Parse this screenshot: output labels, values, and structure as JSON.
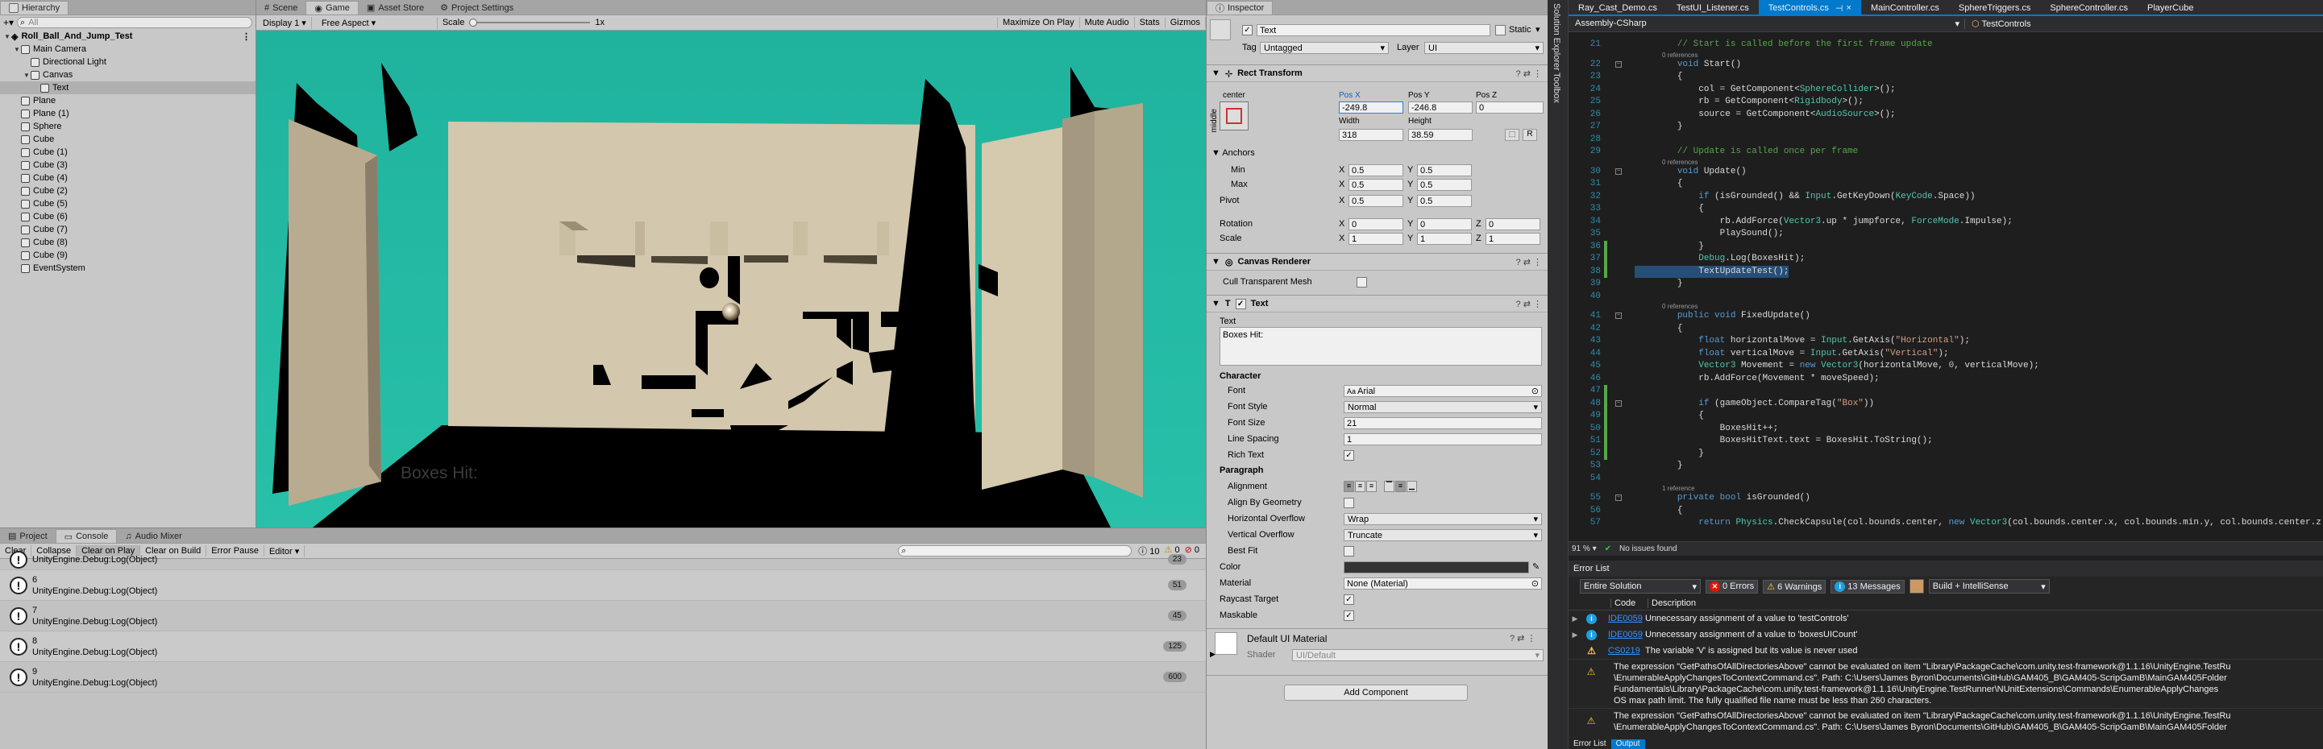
{
  "hierarchy": {
    "tab": "Hierarchy",
    "search_placeholder": "All",
    "scene": "Roll_Ball_And_Jump_Test",
    "items": [
      {
        "label": "Main Camera",
        "depth": 1
      },
      {
        "label": "Directional Light",
        "depth": 2
      },
      {
        "label": "Canvas",
        "depth": 2
      },
      {
        "label": "Text",
        "depth": 3
      },
      {
        "label": "Plane",
        "depth": 1
      },
      {
        "label": "Plane (1)",
        "depth": 1
      },
      {
        "label": "Sphere",
        "depth": 1
      },
      {
        "label": "Cube",
        "depth": 1
      },
      {
        "label": "Cube (1)",
        "depth": 1
      },
      {
        "label": "Cube (3)",
        "depth": 1
      },
      {
        "label": "Cube (4)",
        "depth": 1
      },
      {
        "label": "Cube (2)",
        "depth": 1
      },
      {
        "label": "Cube (5)",
        "depth": 1
      },
      {
        "label": "Cube (6)",
        "depth": 1
      },
      {
        "label": "Cube (7)",
        "depth": 1
      },
      {
        "label": "Cube (8)",
        "depth": 1
      },
      {
        "label": "Cube (9)",
        "depth": 1
      },
      {
        "label": "EventSystem",
        "depth": 1
      }
    ]
  },
  "game": {
    "tabs": [
      "Scene",
      "Game",
      "Asset Store",
      "Project Settings"
    ],
    "display": "Display 1",
    "aspect": "Free Aspect",
    "scale_label": "Scale",
    "scale_value": "1x",
    "buttons": [
      "Maximize On Play",
      "Mute Audio",
      "Stats",
      "Gizmos"
    ],
    "overlay_text": "Boxes Hit:"
  },
  "console": {
    "tabs": [
      "Project",
      "Console",
      "Audio Mixer"
    ],
    "buttons": [
      "Clear",
      "Collapse",
      "Clear on Play",
      "Clear on Build",
      "Error Pause",
      "Editor"
    ],
    "counts": [
      "10",
      "0",
      "0"
    ],
    "rows": [
      {
        "title": "",
        "msg": "UnityEngine.Debug:Log(Object)",
        "count": "23"
      },
      {
        "title": "6",
        "msg": "UnityEngine.Debug:Log(Object)",
        "count": "51"
      },
      {
        "title": "7",
        "msg": "UnityEngine.Debug:Log(Object)",
        "count": "45"
      },
      {
        "title": "8",
        "msg": "UnityEngine.Debug:Log(Object)",
        "count": "125"
      },
      {
        "title": "9",
        "msg": "UnityEngine.Debug:Log(Object)",
        "count": "600"
      }
    ]
  },
  "inspector": {
    "tab": "Inspector",
    "name": "Text",
    "static": "Static",
    "tag_label": "Tag",
    "tag": "Untagged",
    "layer_label": "Layer",
    "layer": "UI",
    "rect": {
      "title": "Rect Transform",
      "anchor_label": "center",
      "side": "middle",
      "posx_l": "Pos X",
      "posy_l": "Pos Y",
      "posz_l": "Pos Z",
      "posx": "-249.8",
      "posy": "-246.8",
      "posz": "0",
      "width_l": "Width",
      "height_l": "Height",
      "width": "318",
      "height": "38.59",
      "r": "R",
      "anchors": "Anchors",
      "min": "Min",
      "max": "Max",
      "pivot": "Pivot",
      "minx": "0.5",
      "miny": "0.5",
      "maxx": "0.5",
      "maxy": "0.5",
      "pivx": "0.5",
      "pivy": "0.5",
      "rotation": "Rotation",
      "scale": "Scale",
      "rx": "0",
      "ry": "0",
      "rz": "0",
      "sx": "1",
      "sy": "1",
      "sz": "1"
    },
    "canvas_renderer": {
      "title": "Canvas Renderer",
      "cull": "Cull Transparent Mesh"
    },
    "text": {
      "title": "Text",
      "text_label": "Text",
      "text_value": "Boxes Hit:",
      "character": "Character",
      "font_l": "Font",
      "font": "Arial",
      "style_l": "Font Style",
      "style": "Normal",
      "size_l": "Font Size",
      "size": "21",
      "spacing_l": "Line Spacing",
      "spacing": "1",
      "rich_l": "Rich Text",
      "paragraph": "Paragraph",
      "align_l": "Alignment",
      "geom_l": "Align By Geometry",
      "hov_l": "Horizontal Overflow",
      "hov": "Wrap",
      "vov_l": "Vertical Overflow",
      "vov": "Truncate",
      "bestfit_l": "Best Fit",
      "color_l": "Color",
      "material_l": "Material",
      "material": "None (Material)",
      "raycast_l": "Raycast Target",
      "maskable_l": "Maskable"
    },
    "default_mat": "Default UI Material",
    "shader_l": "Shader",
    "shader": "UI/Default",
    "add_component": "Add Component"
  },
  "vs": {
    "side_labels": [
      "Solution Explorer",
      "Toolbox"
    ],
    "tabs": [
      "Ray_Cast_Demo.cs",
      "TestUI_Listener.cs",
      "TestControls.cs",
      "MainController.cs",
      "SphereTriggers.cs",
      "SphereController.cs",
      "PlayerCube"
    ],
    "active_tab": "TestControls.cs",
    "nav_left": "Assembly-CSharp",
    "nav_right": "TestControls",
    "zoom": "91 %",
    "status": "No issues found",
    "code": [
      {
        "n": "21",
        "t": "        // Start is called before the first frame update"
      },
      {
        "ref": "0 references"
      },
      {
        "n": "22",
        "t": "        void Start()"
      },
      {
        "n": "23",
        "t": "        {"
      },
      {
        "n": "24",
        "t": "            col = GetComponent<SphereCollider>();"
      },
      {
        "n": "25",
        "t": "            rb = GetComponent<Rigidbody>();"
      },
      {
        "n": "26",
        "t": "            source = GetComponent<AudioSource>();"
      },
      {
        "n": "27",
        "t": "        }"
      },
      {
        "n": "28",
        "t": ""
      },
      {
        "n": "29",
        "t": "        // Update is called once per frame"
      },
      {
        "ref": "0 references"
      },
      {
        "n": "30",
        "t": "        void Update()"
      },
      {
        "n": "31",
        "t": "        {"
      },
      {
        "n": "32",
        "t": "            if (isGrounded() && Input.GetKeyDown(KeyCode.Space))"
      },
      {
        "n": "33",
        "t": "            {"
      },
      {
        "n": "34",
        "t": "                rb.AddForce(Vector3.up * jumpforce, ForceMode.Impulse);"
      },
      {
        "n": "35",
        "t": "                PlaySound();"
      },
      {
        "n": "36",
        "t": "            }"
      },
      {
        "n": "37",
        "t": "            Debug.Log(BoxesHit);"
      },
      {
        "n": "38",
        "t": "            TextUpdateTest();"
      },
      {
        "n": "39",
        "t": "        }"
      },
      {
        "n": "40",
        "t": ""
      },
      {
        "ref": "0 references"
      },
      {
        "n": "41",
        "t": "        public void FixedUpdate()"
      },
      {
        "n": "42",
        "t": "        {"
      },
      {
        "n": "43",
        "t": "            float horizontalMove = Input.GetAxis(\"Horizontal\");"
      },
      {
        "n": "44",
        "t": "            float verticalMove = Input.GetAxis(\"Vertical\");"
      },
      {
        "n": "45",
        "t": "            Vector3 Movement = new Vector3(horizontalMove, 0, verticalMove);"
      },
      {
        "n": "46",
        "t": "            rb.AddForce(Movement * moveSpeed);"
      },
      {
        "n": "47",
        "t": ""
      },
      {
        "n": "48",
        "t": "            if (gameObject.CompareTag(\"Box\"))"
      },
      {
        "n": "49",
        "t": "            {"
      },
      {
        "n": "50",
        "t": "                BoxesHit++;"
      },
      {
        "n": "51",
        "t": "                BoxesHitText.text = BoxesHit.ToString();"
      },
      {
        "n": "52",
        "t": "            }"
      },
      {
        "n": "53",
        "t": "        }"
      },
      {
        "n": "54",
        "t": ""
      },
      {
        "ref": "1 reference"
      },
      {
        "n": "55",
        "t": "        private bool isGrounded()"
      },
      {
        "n": "56",
        "t": "        {"
      },
      {
        "n": "57",
        "t": "            return Physics.CheckCapsule(col.bounds.center, new Vector3(col.bounds.center.x, col.bounds.min.y, col.bounds.center.z), col"
      }
    ],
    "errorlist": {
      "title": "Error List",
      "scope": "Entire Solution",
      "errors": "0 Errors",
      "warnings": "6 Warnings",
      "messages": "13 Messages",
      "build": "Build + IntelliSense",
      "col_code": "Code",
      "col_desc": "Description",
      "rows": [
        {
          "kind": "info",
          "code": "IDE0059",
          "desc": "Unnecessary assignment of a value to 'testControls'"
        },
        {
          "kind": "info",
          "code": "IDE0059",
          "desc": "Unnecessary assignment of a value to 'boxesUICount'"
        },
        {
          "kind": "warn",
          "code": "CS0219",
          "desc": "The variable 'V' is assigned but its value is never used"
        }
      ],
      "long1": [
        "The expression \"GetPathsOfAllDirectoriesAbove\" cannot be evaluated on item \"Library\\PackageCache\\com.unity.test-framework@1.1.16\\UnityEngine.TestRu",
        "\\EnumerableApplyChangesToContextCommand.cs\". Path: C:\\Users\\James Byron\\Documents\\GitHub\\GAM405_B\\GAM405-ScripGamB\\MainGAM405Folder",
        "Fundamentals\\Library\\PackageCache\\com.unity.test-framework@1.1.16\\UnityEngine.TestRunner\\NUnitExtensions\\Commands\\EnumerableApplyChanges",
        "OS max path limit. The fully qualified file name must be less than 260 characters."
      ],
      "long2": [
        "The expression \"GetPathsOfAllDirectoriesAbove\" cannot be evaluated on item \"Library\\PackageCache\\com.unity.test-framework@1.1.16\\UnityEngine.TestRu",
        "\\EnumerableApplyChangesToContextCommand.cs\". Path: C:\\Users\\James Byron\\Documents\\GitHub\\GAM405_B\\GAM405-ScripGamB\\MainGAM405Folder"
      ],
      "bottom_tabs": [
        "Error List",
        "Output"
      ]
    }
  },
  "colors": {
    "sky": "#2ab5a0",
    "wall": "#cfc3a8",
    "vs_bg": "#1e1e1e",
    "accent": "#007acc"
  }
}
